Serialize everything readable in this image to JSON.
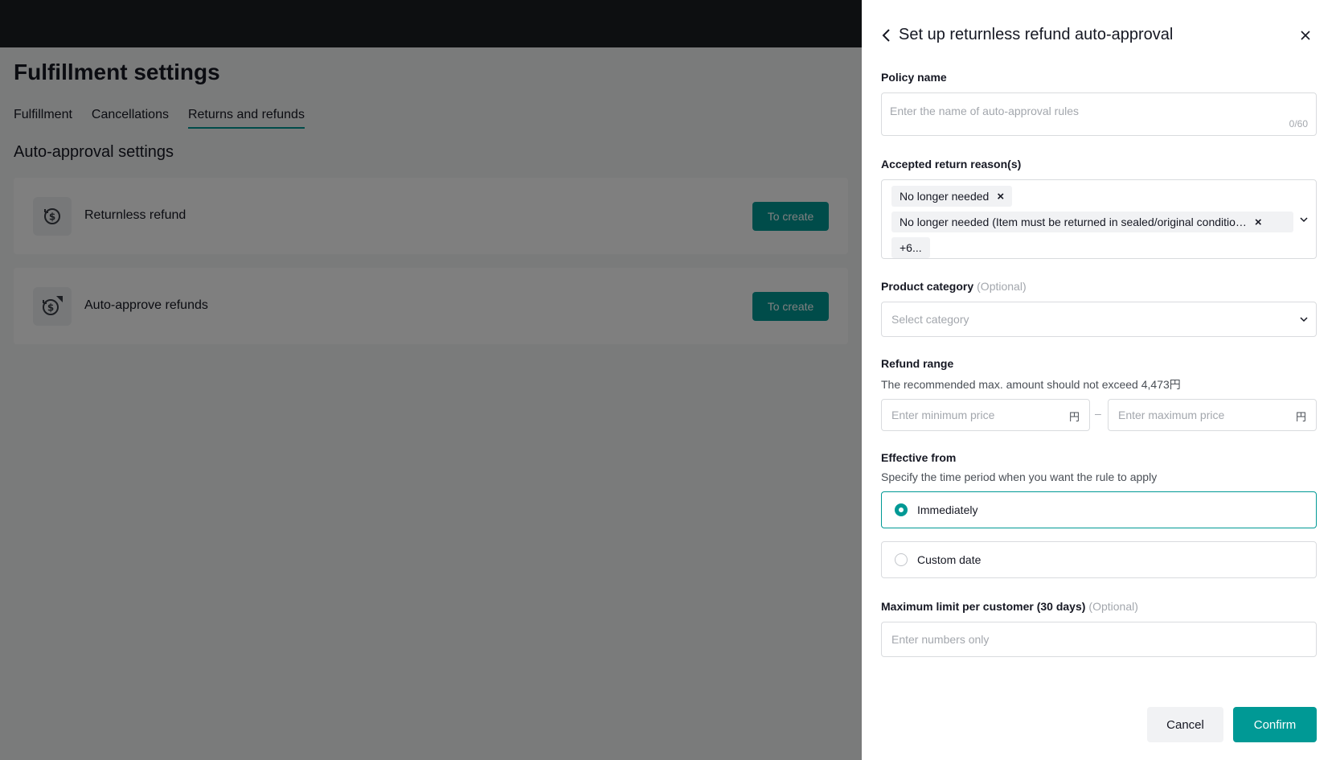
{
  "background": {
    "page_title": "Fulfillment settings",
    "tabs": [
      {
        "label": "Fulfillment"
      },
      {
        "label": "Cancellations"
      },
      {
        "label": "Returns and refunds",
        "active": true
      }
    ],
    "section_title": "Auto-approval settings",
    "cards": [
      {
        "label": "Returnless refund",
        "button": "To create"
      },
      {
        "label": "Auto-approve refunds",
        "button": "To create"
      }
    ]
  },
  "drawer": {
    "title": "Set up returnless refund auto-approval",
    "policy_name": {
      "label": "Policy name",
      "placeholder": "Enter the name of auto-approval rules",
      "counter": "0/60"
    },
    "reasons": {
      "label": "Accepted return reason(s)",
      "tags": [
        "No longer needed",
        "No longer needed (Item must be returned in sealed/original conditio…",
        "+6..."
      ]
    },
    "category": {
      "label": "Product category",
      "optional": "(Optional)",
      "placeholder": "Select category"
    },
    "refund_range": {
      "label": "Refund range",
      "helper": "The recommended max. amount should not exceed 4,473円",
      "min_placeholder": "Enter minimum price",
      "max_placeholder": "Enter maximum price",
      "currency": "円",
      "separator": "–"
    },
    "effective": {
      "label": "Effective from",
      "helper": "Specify the time period when you want the rule to apply",
      "options": [
        {
          "label": "Immediately",
          "selected": true
        },
        {
          "label": "Custom date",
          "selected": false
        }
      ]
    },
    "limit": {
      "label": "Maximum limit per customer (30 days)",
      "optional": "(Optional)",
      "placeholder": "Enter numbers only"
    },
    "buttons": {
      "cancel": "Cancel",
      "confirm": "Confirm"
    }
  },
  "colors": {
    "accent": "#009995",
    "topbar": "#1b1e23"
  }
}
